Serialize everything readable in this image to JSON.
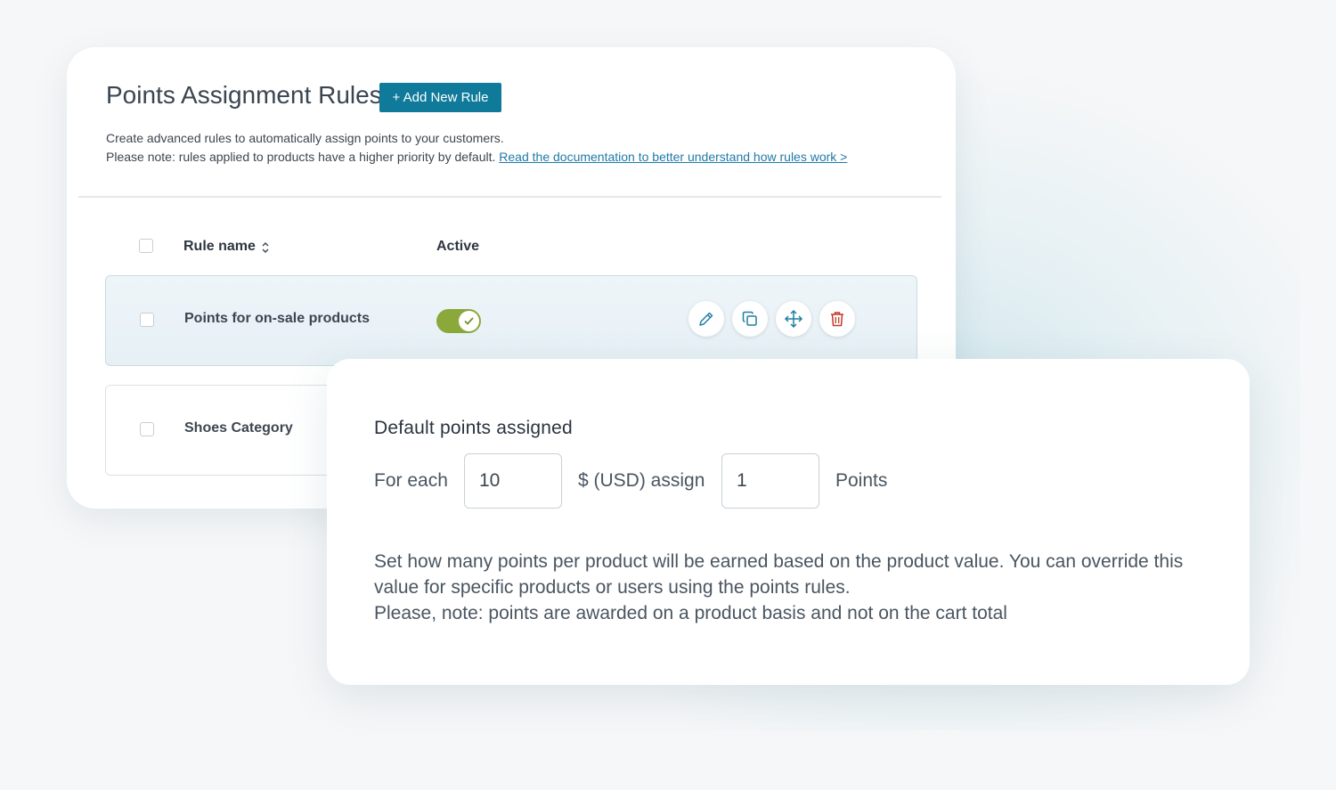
{
  "rules_panel": {
    "title": "Points Assignment Rules",
    "add_button": "+ Add New Rule",
    "description_line1": "Create advanced rules to automatically assign points to your customers.",
    "description_line2": "Please note: rules applied to products have a higher priority by default.",
    "doc_link": "Read the documentation to better understand how rules work >",
    "columns": {
      "rule_name": "Rule name",
      "active": "Active"
    },
    "rows": [
      {
        "name": "Points for on-sale products",
        "active": true
      },
      {
        "name": "Shoes Category"
      }
    ]
  },
  "default_points": {
    "title": "Default points assigned",
    "for_each_label": "For each",
    "amount_value": "10",
    "currency_label": "$ (USD) assign",
    "points_value": "1",
    "points_label": "Points",
    "help_line1": "Set how many points per product will be earned based on the product value. You can override this",
    "help_line2": "value for specific products or users using the points rules.",
    "help_line3": "Please, note: points are awarded on a product basis and not on the cart total"
  },
  "colors": {
    "accent": "#0f7a9a",
    "toggle_on": "#8ba83a",
    "delete_icon": "#c0392b",
    "link": "#1f7aa8"
  }
}
